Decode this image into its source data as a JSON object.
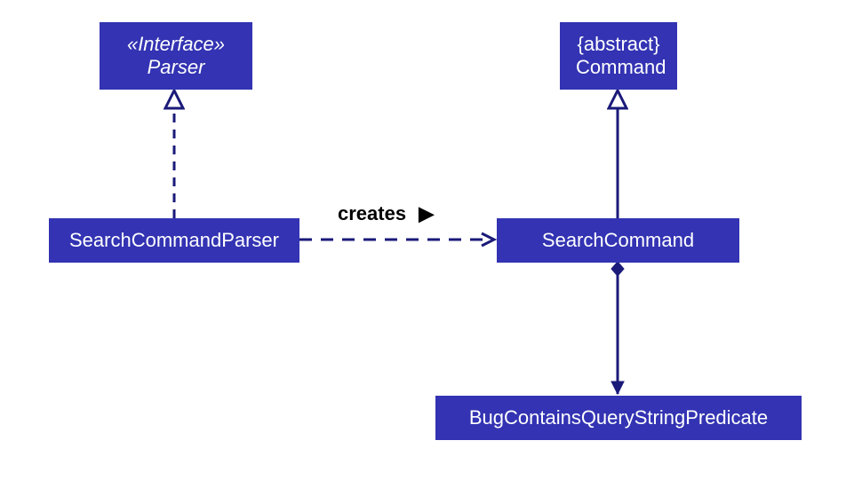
{
  "boxes": {
    "parser_interface": {
      "stereotype": "«Interface»",
      "name": "Parser"
    },
    "command_abstract": {
      "stereotype": "{abstract}",
      "name": "Command"
    },
    "search_command_parser": {
      "name": "SearchCommandParser"
    },
    "search_command": {
      "name": "SearchCommand"
    },
    "predicate": {
      "name": "BugContainsQueryStringPredicate"
    }
  },
  "edges": {
    "creates": {
      "label": "creates"
    }
  },
  "colors": {
    "box_bg": "#3333b3",
    "box_text": "#ffffff",
    "edge": "#1a1a7a",
    "label": "#000000"
  }
}
